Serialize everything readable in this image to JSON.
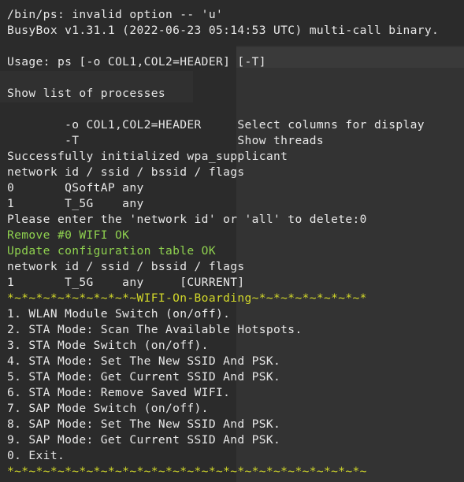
{
  "terminal": {
    "lines": [
      {
        "text": "/bin/ps: invalid option -- 'u'",
        "color": "default"
      },
      {
        "text": "BusyBox v1.31.1 (2022-06-23 05:14:53 UTC) multi-call binary.",
        "color": "default"
      },
      {
        "text": "",
        "color": "default"
      },
      {
        "text": "Usage: ps [-o COL1,COL2=HEADER] [-T]",
        "color": "default"
      },
      {
        "text": "",
        "color": "default"
      },
      {
        "text": "Show list of processes",
        "color": "default"
      },
      {
        "text": "",
        "color": "default"
      },
      {
        "text": "        -o COL1,COL2=HEADER     Select columns for display",
        "color": "default"
      },
      {
        "text": "        -T                      Show threads",
        "color": "default"
      },
      {
        "text": "Successfully initialized wpa_supplicant",
        "color": "default"
      },
      {
        "text": "network id / ssid / bssid / flags",
        "color": "default"
      },
      {
        "text": "0       QSoftAP any",
        "color": "default"
      },
      {
        "text": "1       T_5G    any",
        "color": "default"
      },
      {
        "text": "Please enter the 'network id' or 'all' to delete:0",
        "color": "default"
      },
      {
        "text": "Remove #0 WIFI OK",
        "color": "green"
      },
      {
        "text": "Update configuration table OK",
        "color": "green"
      },
      {
        "text": "network id / ssid / bssid / flags",
        "color": "default"
      },
      {
        "text": "1       T_5G    any     [CURRENT]",
        "color": "default"
      },
      {
        "text": "*~*~*~*~*~*~*~*~*~WIFI-On-Boarding~*~*~*~*~*~*~*~*",
        "color": "border"
      },
      {
        "text": "1. WLAN Module Switch (on/off).",
        "color": "default"
      },
      {
        "text": "2. STA Mode: Scan The Available Hotspots.",
        "color": "default"
      },
      {
        "text": "3. STA Mode Switch (on/off).",
        "color": "default"
      },
      {
        "text": "4. STA Mode: Set The New SSID And PSK.",
        "color": "default"
      },
      {
        "text": "5. STA Mode: Get Current SSID And PSK.",
        "color": "default"
      },
      {
        "text": "6. STA Mode: Remove Saved WIFI.",
        "color": "default"
      },
      {
        "text": "7. SAP Mode Switch (on/off).",
        "color": "default"
      },
      {
        "text": "8. SAP Mode: Set The New SSID And PSK.",
        "color": "default"
      },
      {
        "text": "9. SAP Mode: Get Current SSID And PSK.",
        "color": "default"
      },
      {
        "text": "0. Exit.",
        "color": "default"
      },
      {
        "text": "*~*~*~*~*~*~*~*~*~*~*~*~*~*~*~*~*~*~*~*~*~*~*~*~*~",
        "color": "border"
      }
    ]
  },
  "colors": {
    "background": "#2b2b2b",
    "text": "#e8e8e8",
    "success": "#8fd14f",
    "banner": "#d3d92a"
  }
}
